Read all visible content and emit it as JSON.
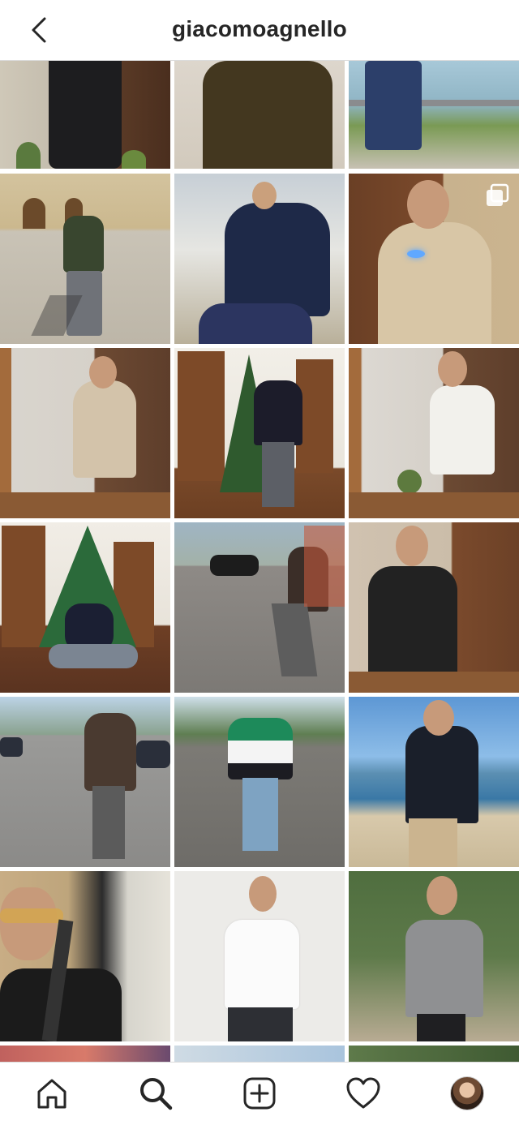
{
  "header": {
    "title": "giacomoagnello",
    "back_icon": "chevron-left-icon"
  },
  "grid": {
    "post_count_visible": 18,
    "multi_photo_indicator": "carousel-icon",
    "posts": [
      {
        "scene": "mirror-selfie-black-outfit",
        "palette": [
          "#c9c2b3",
          "#3a2a22"
        ]
      },
      {
        "scene": "olive-sweater-closeup",
        "palette": [
          "#d9d2c8",
          "#4b3c25"
        ]
      },
      {
        "scene": "seaside-railing-pose",
        "palette": [
          "#9fc4d6",
          "#2f3f66"
        ]
      },
      {
        "scene": "town-square-green-sweater",
        "palette": [
          "#c8bfae",
          "#3f4a3a"
        ]
      },
      {
        "scene": "navy-jacket-sunglasses",
        "palette": [
          "#bcc6ce",
          "#1e2944"
        ]
      },
      {
        "scene": "beige-sweater-gadget",
        "palette": [
          "#b98a5a",
          "#d9c9ad"
        ]
      },
      {
        "scene": "mirror-selfie-beige-sweater",
        "palette": [
          "#d8d5cf",
          "#6a4630"
        ]
      },
      {
        "scene": "christmas-tree-kenzo",
        "palette": [
          "#7a4a2a",
          "#1c1c2a"
        ]
      },
      {
        "scene": "mirror-selfie-white-tee",
        "palette": [
          "#dcd8d2",
          "#6c4a33"
        ]
      },
      {
        "scene": "sitting-christmas-tree",
        "palette": [
          "#6e3f25",
          "#2b6a3a"
        ]
      },
      {
        "scene": "street-car-brown-sweater",
        "palette": [
          "#8e8a86",
          "#3b2e28"
        ]
      },
      {
        "scene": "leather-jacket-mirror",
        "palette": [
          "#ccbfae",
          "#222222"
        ]
      },
      {
        "scene": "street-sunglasses-walk",
        "palette": [
          "#9a9a98",
          "#4a3a30"
        ]
      },
      {
        "scene": "fila-sweater-park",
        "palette": [
          "#7c7a75",
          "#1d8a5a"
        ]
      },
      {
        "scene": "beach-dark-jacket",
        "palette": [
          "#6fa7d8",
          "#d8c9ab"
        ]
      },
      {
        "scene": "car-selfie-aviators",
        "palette": [
          "#bfae92",
          "#1b1b1b"
        ]
      },
      {
        "scene": "white-tee-studio",
        "palette": [
          "#ecebe8",
          "#fbfbfb"
        ]
      },
      {
        "scene": "grey-ck-tee-garden",
        "palette": [
          "#5e7a4a",
          "#8f9092"
        ]
      }
    ]
  },
  "tabbar": {
    "items": [
      {
        "name": "home",
        "icon": "home-icon"
      },
      {
        "name": "search",
        "icon": "search-icon",
        "active": true
      },
      {
        "name": "new-post",
        "icon": "plus-square-icon"
      },
      {
        "name": "activity",
        "icon": "heart-icon"
      },
      {
        "name": "profile",
        "icon": "avatar"
      }
    ]
  },
  "colors": {
    "text": "#262626",
    "divider": "#dbdbdb",
    "background": "#ffffff"
  }
}
